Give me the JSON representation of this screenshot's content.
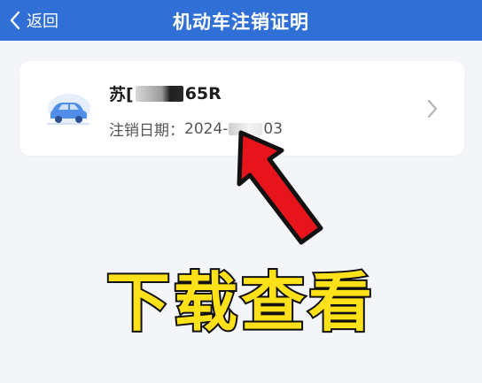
{
  "header": {
    "back_label": "返回",
    "title": "机动车注销证明",
    "color": "#2f6fd6"
  },
  "card": {
    "plate_prefix": "苏[",
    "plate_suffix": "65R",
    "date_label": "注销日期：",
    "date_start": "2024-",
    "date_end": "03",
    "icon": "car-icon",
    "chevron": "chevron-right-icon"
  },
  "overlay": {
    "text": "下载查看",
    "text_color": "#ffe11a",
    "arrow_color": "#e8141c"
  }
}
